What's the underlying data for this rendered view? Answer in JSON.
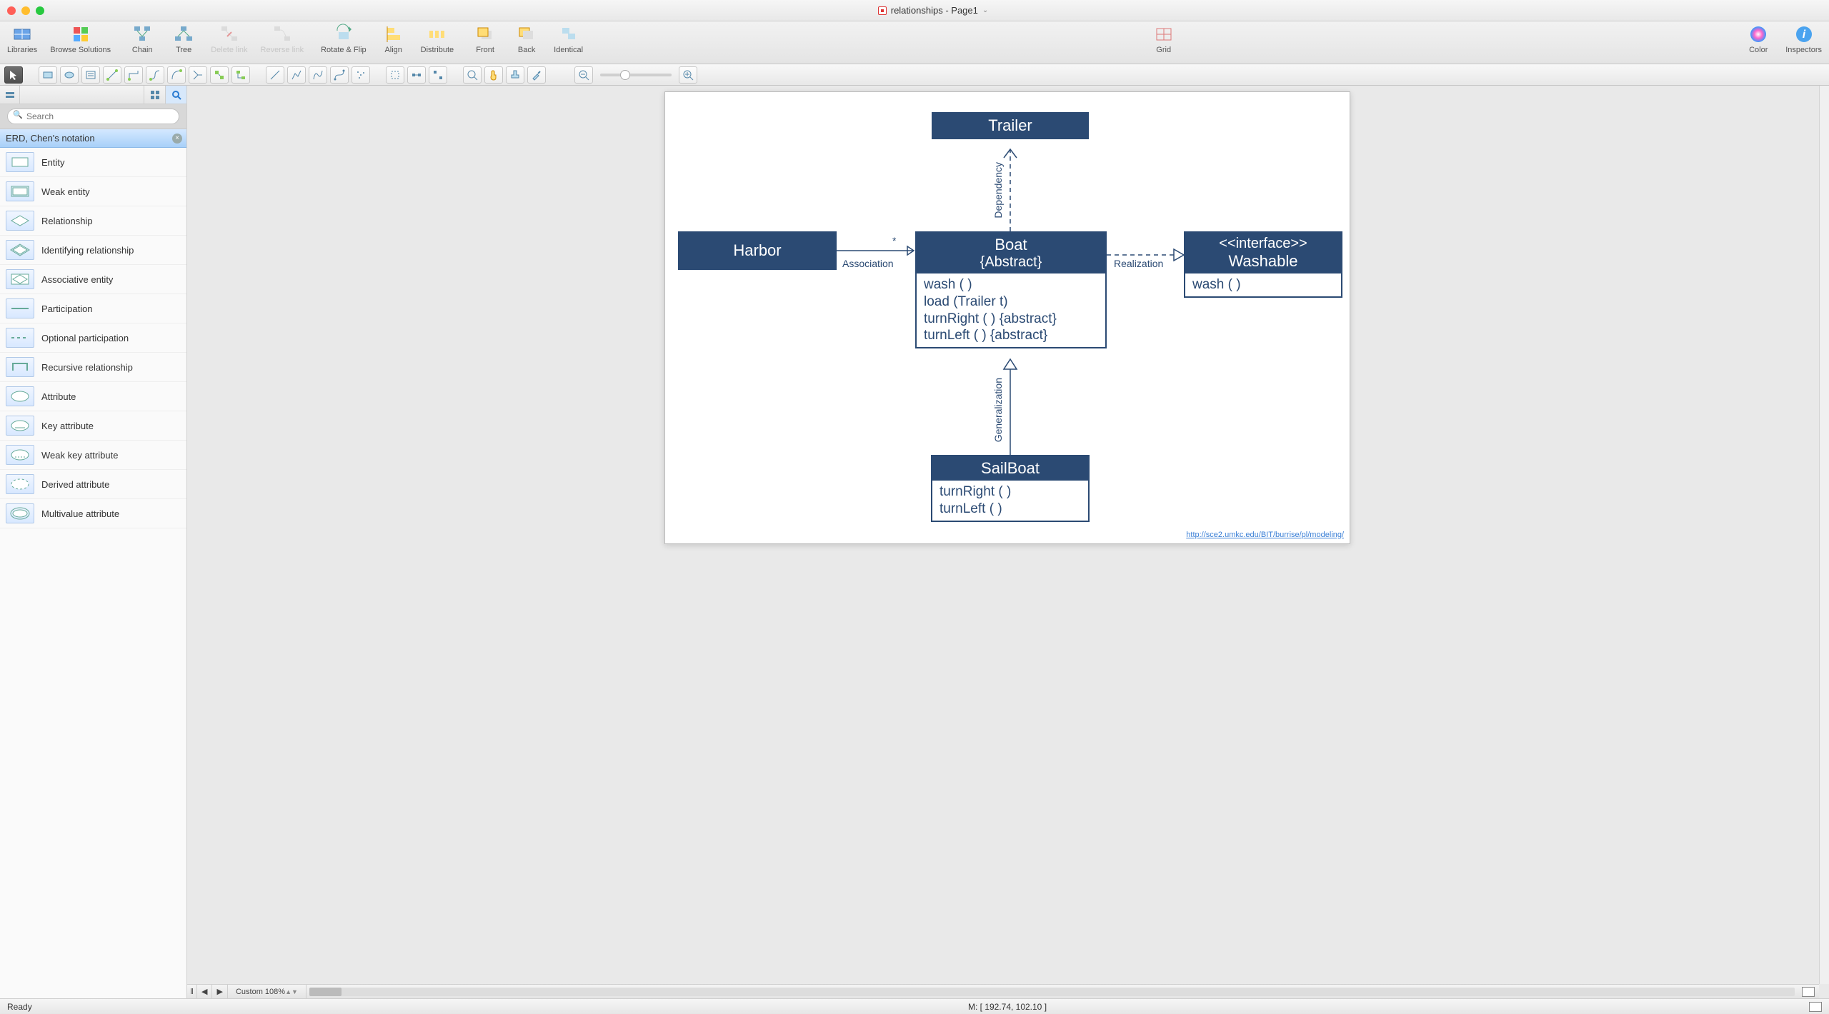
{
  "window": {
    "title": "relationships - Page1"
  },
  "toolbar": {
    "libraries": "Libraries",
    "browse": "Browse Solutions",
    "chain": "Chain",
    "tree": "Tree",
    "delete_link": "Delete link",
    "reverse_link": "Reverse link",
    "rotate_flip": "Rotate & Flip",
    "align": "Align",
    "distribute": "Distribute",
    "front": "Front",
    "back": "Back",
    "identical": "Identical",
    "grid": "Grid",
    "color": "Color",
    "inspectors": "Inspectors"
  },
  "sidebar": {
    "search_placeholder": "Search",
    "header": "ERD, Chen's notation",
    "items": [
      "Entity",
      "Weak entity",
      "Relationship",
      "Identifying relationship",
      "Associative entity",
      "Participation",
      "Optional participation",
      "Recursive relationship",
      "Attribute",
      "Key attribute",
      "Weak key attribute",
      "Derived attribute",
      "Multivalue attribute"
    ]
  },
  "diagram": {
    "trailer": {
      "title": "Trailer"
    },
    "harbor": {
      "title": "Harbor"
    },
    "boat": {
      "title": "Boat",
      "subtitle": "{Abstract}",
      "methods": [
        "wash ( )",
        "load (Trailer t)",
        "turnRight ( ) {abstract}",
        "turnLeft ( ) {abstract}"
      ]
    },
    "washable": {
      "stereotype": "<<interface>>",
      "title": "Washable",
      "methods": [
        "wash ( )"
      ]
    },
    "sailboat": {
      "title": "SailBoat",
      "methods": [
        "turnRight ( )",
        "turnLeft ( )"
      ]
    },
    "labels": {
      "association": "Association",
      "star": "*",
      "realization": "Realization",
      "dependency": "Dependency",
      "generalization": "Generalization"
    },
    "url": "http://sce2.umkc.edu/BIT/burrise/pl/modeling/"
  },
  "bottombar": {
    "zoom_label": "Custom 108%"
  },
  "status": {
    "ready": "Ready",
    "mouse": "M: [ 192.74, 102.10 ]"
  }
}
